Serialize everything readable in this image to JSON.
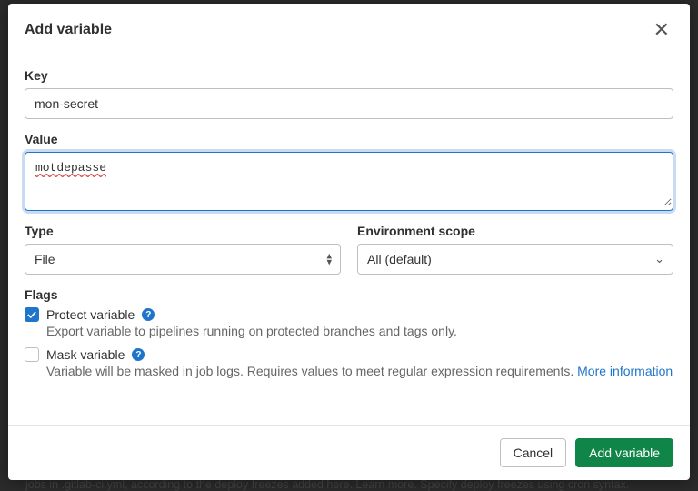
{
  "modal": {
    "title": "Add variable",
    "key_label": "Key",
    "key_value": "mon-secret",
    "value_label": "Value",
    "value_value": "motdepasse",
    "type_label": "Type",
    "type_value": "File",
    "scope_label": "Environment scope",
    "scope_value": "All (default)",
    "flags_label": "Flags",
    "flags": {
      "protect": {
        "label": "Protect variable",
        "desc": "Export variable to pipelines running on protected branches and tags only.",
        "checked": true
      },
      "mask": {
        "label": "Mask variable",
        "desc": "Variable will be masked in job logs. Requires values to meet regular expression requirements. ",
        "more_info": "More information",
        "checked": false
      }
    },
    "cancel": "Cancel",
    "submit": "Add variable"
  }
}
